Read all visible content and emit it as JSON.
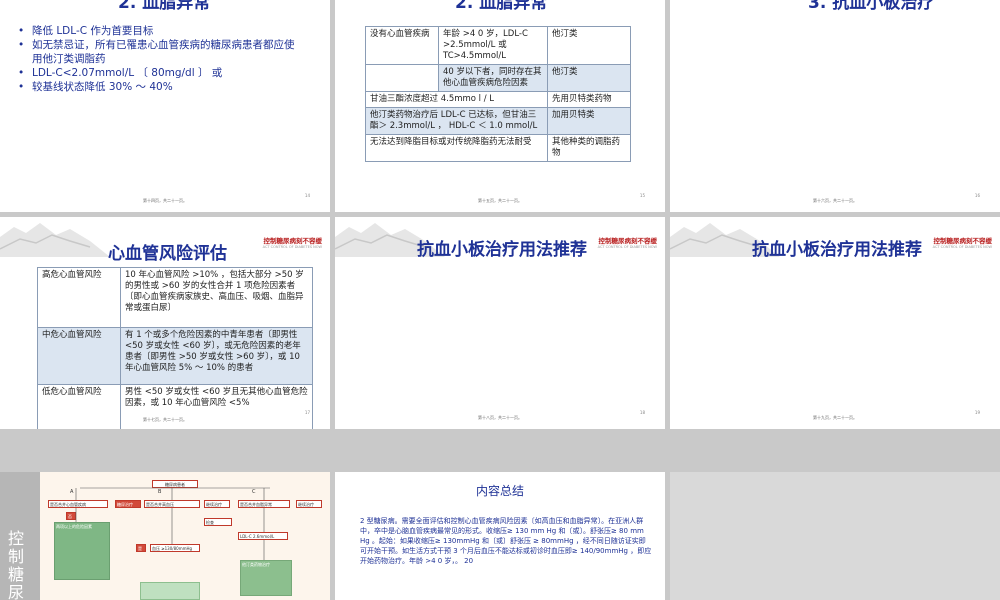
{
  "slides": [
    {
      "title": "2. 血脂异常",
      "bullets": [
        "降低 LDL-C 作为首要目标",
        "如无禁忌证，所有已罹患心血管疾病的糖尿病患者都应使用他汀类调脂药",
        "LDL-C<2.07mmol/L 〔 80mg/dl 〕 或",
        "较基线状态降低 30% ～ 40%"
      ],
      "footer": "第十四页，共二十一页。",
      "page": "14"
    },
    {
      "title": "2. 血脂异常",
      "table": [
        [
          "没有心血管疾病",
          "年龄 >4 0  岁，LDL-C >2.5mmol/L 或 TC>4.5mmol/L",
          "他汀类"
        ],
        [
          "",
          "40 岁以下者，同时存在其他心血管疾病危险因素",
          "他汀类"
        ],
        [
          "甘油三酯浓度超过 4.5mmo l / L",
          "",
          "先用贝特类药物"
        ],
        [
          "他汀类药物治疗后 LDL-C 已达标，但甘油三酯＞ 2.3mmol/L ， HDL-C ＜ 1.0 mmol/L",
          "",
          "加用贝特类"
        ],
        [
          "无法达到降脂目标或对传统降脂药无法耐受",
          "",
          "其他种类的调脂药物"
        ]
      ],
      "footer": "第十五页，共二十一页。",
      "page": "15"
    },
    {
      "title": "3. 抗血小板治疗",
      "footer": "第十六页，共二十一页。",
      "page": "16"
    },
    {
      "title": "心血管风险评估",
      "brand": "控制糖尿病刻不容缓",
      "brand_sub": "ACT  CONTROL OF DIABETES NOW",
      "table": [
        [
          "高危心血管风险",
          "10 年心血管风险 >10% ，包括大部分 >50 岁的男性或 >60 岁的女性合并 1 项危险因素者〔即心血管疾病家族史、高血压、吸烟、血脂异常或蛋白尿〕"
        ],
        [
          "中危心血管风险",
          "有 1 个或多个危险因素的中青年患者〔即男性 <50 岁或女性 <60 岁〕，或无危险因素的老年患者〔即男性 >50 岁或女性 >60 岁〕，或 10 年心血管风险 5% ～ 10% 的患者"
        ],
        [
          "低危心血管风险",
          "男性 <50 岁或女性 <60 岁且无其他心血管危险因素，或 10 年心血管风险 <5%"
        ]
      ],
      "footer": "第十七页，共二十一页。",
      "page": "17"
    },
    {
      "title": "抗血小板治疗用法推荐",
      "brand": "控制糖尿病刻不容缓",
      "brand_sub": "ACT  CONTROL OF DIABETES NOW",
      "footer": "第十八页，共二十一页。",
      "page": "18"
    },
    {
      "title": "抗血小板治疗用法推荐",
      "brand": "控制糖尿病刻不容缓",
      "brand_sub": "ACT  CONTROL OF DIABETES NOW",
      "footer": "第十九页，共二十一页。",
      "page": "19"
    }
  ],
  "flow": {
    "sidebar_text": "控制糖尿",
    "top_box": "糖尿病患者",
    "branches": [
      "A",
      "B",
      "C"
    ],
    "box_a": "是否合并心血管疾病",
    "box_b": "是否合并高血压",
    "box_c": "是否合并血脂异常",
    "action_a": "糖尿治疗",
    "action_b": "继续治疗",
    "action_c": "继续治疗",
    "label_no": "否",
    "label_yes": "是",
    "list_title": "两项以上的危险因素",
    "bp_box": "血压 ≥130/80mmHg",
    "ldl_box": "LDL-C 2.6mmol/L",
    "check": "检查",
    "treat_drug": "他汀类药物治疗"
  },
  "summary": {
    "title": "内容总结",
    "text": "2 型糖尿病。需要全面评估和控制心血管疾病风险因素〔如高血压和血脂异常〕。在亚洲人群中，卒中是心脑血管疾病最常见的形式。收缩压≥ 130 mm Hg 和〔或〕。舒张压≥ 80 mm Hg 。起始：如果收缩压≥ 130mmHg 和〔或〕舒张压 ≥ 80mmHg ，经不同日随访证实即可开始干预。如生活方式干预 3 个月后血压不能达标或初诊时血压即≥ 140/90mmHg ，即应开始药物治疗。年龄 >4 0  岁，。 20"
  }
}
